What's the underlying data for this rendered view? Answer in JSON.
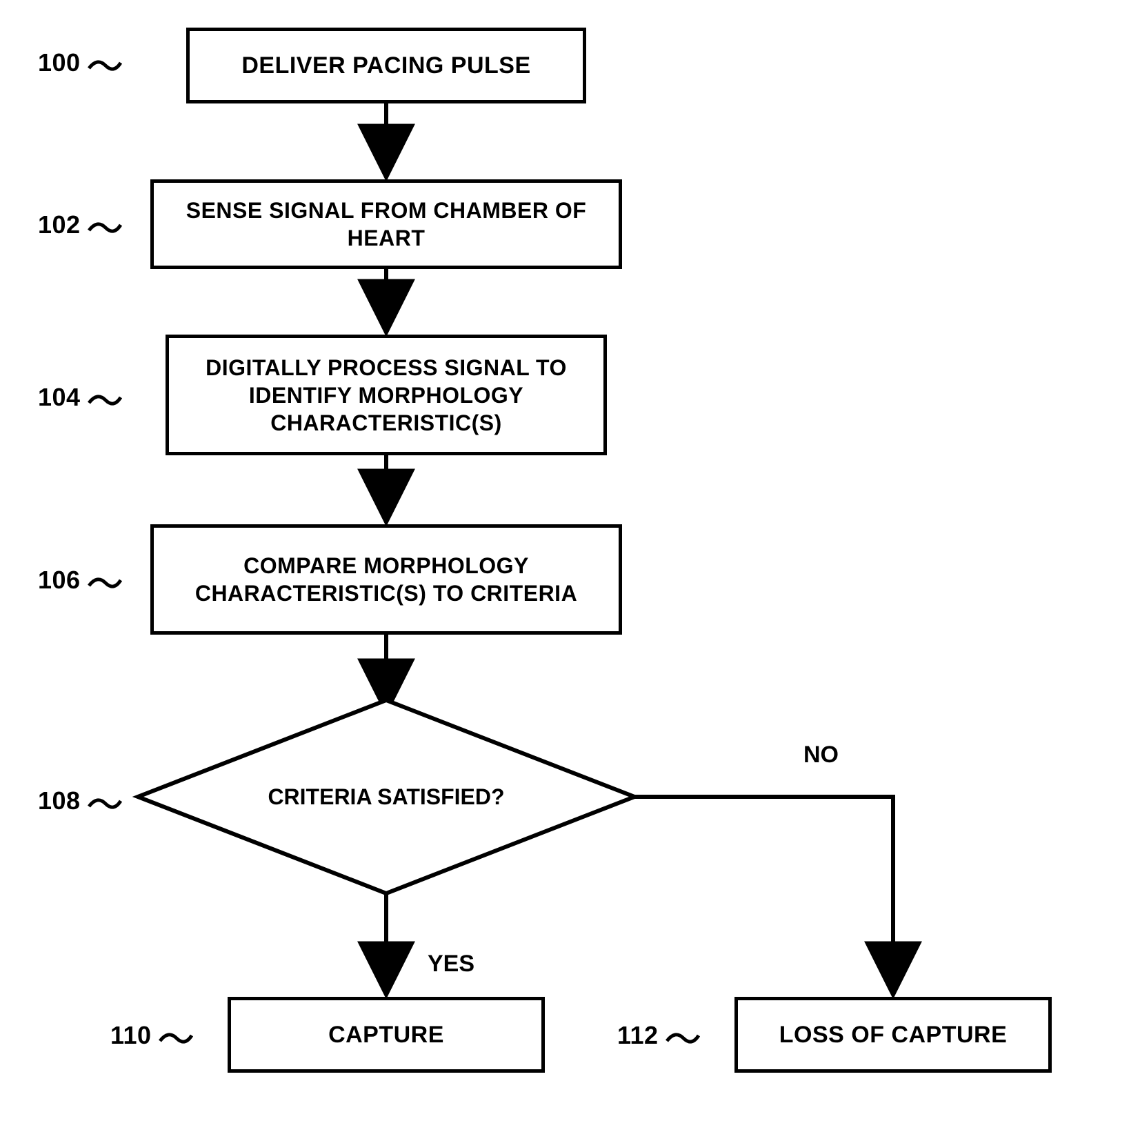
{
  "chart_data": {
    "type": "flowchart",
    "title": "",
    "nodes": [
      {
        "id": "100",
        "kind": "process",
        "text": "DELIVER PACING PULSE"
      },
      {
        "id": "102",
        "kind": "process",
        "text": "SENSE SIGNAL FROM CHAMBER OF HEART"
      },
      {
        "id": "104",
        "kind": "process",
        "text": "DIGITALLY PROCESS SIGNAL TO IDENTIFY MORPHOLOGY CHARACTERISTIC(S)"
      },
      {
        "id": "106",
        "kind": "process",
        "text": "COMPARE MORPHOLOGY CHARACTERISTIC(S) TO CRITERIA"
      },
      {
        "id": "108",
        "kind": "decision",
        "text": "CRITERIA SATISFIED?"
      },
      {
        "id": "110",
        "kind": "process",
        "text": "CAPTURE"
      },
      {
        "id": "112",
        "kind": "process",
        "text": "LOSS OF CAPTURE"
      }
    ],
    "edges": [
      {
        "from": "100",
        "to": "102",
        "label": ""
      },
      {
        "from": "102",
        "to": "104",
        "label": ""
      },
      {
        "from": "104",
        "to": "106",
        "label": ""
      },
      {
        "from": "106",
        "to": "108",
        "label": ""
      },
      {
        "from": "108",
        "to": "110",
        "label": "YES"
      },
      {
        "from": "108",
        "to": "112",
        "label": "NO"
      }
    ]
  },
  "refs": {
    "100": "100",
    "102": "102",
    "104": "104",
    "106": "106",
    "108": "108",
    "110": "110",
    "112": "112"
  },
  "decision": {
    "yes": "YES",
    "no": "NO"
  }
}
